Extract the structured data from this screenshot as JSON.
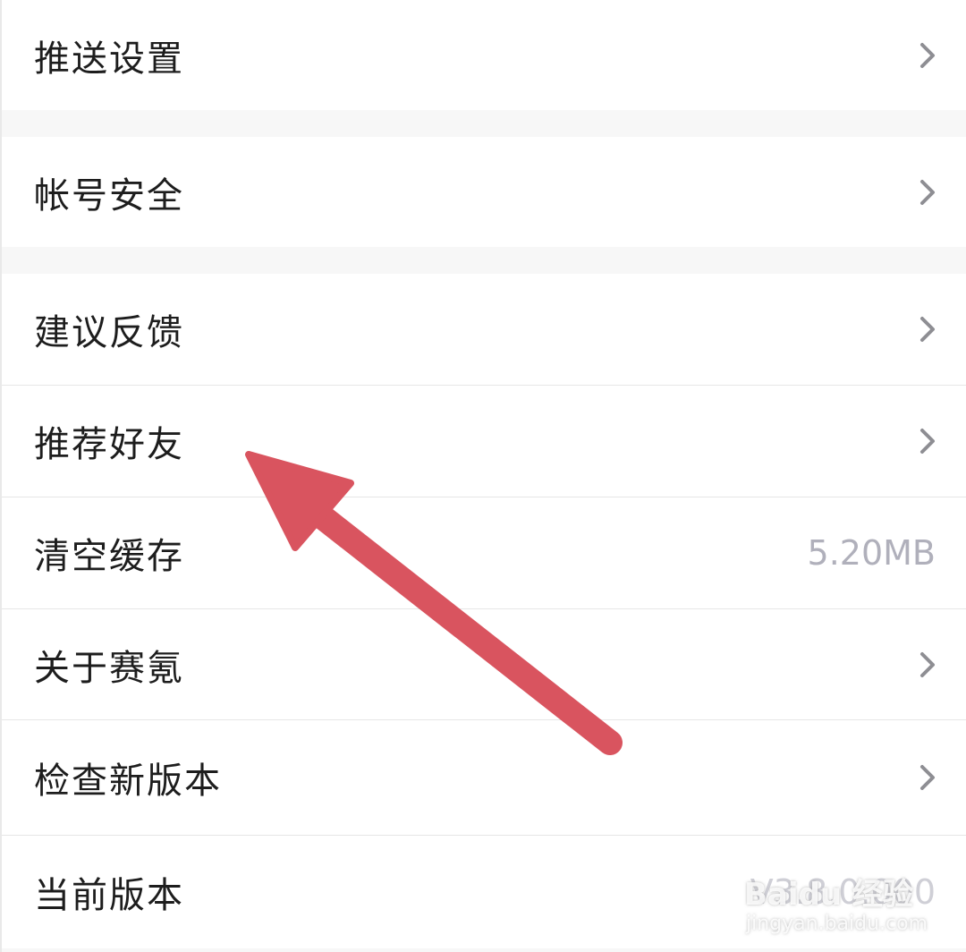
{
  "settings": {
    "items": [
      {
        "label": "推送设置",
        "trailing": "chevron"
      },
      {
        "label": "帐号安全",
        "trailing": "chevron"
      },
      {
        "label": "建议反馈",
        "trailing": "chevron"
      },
      {
        "label": "推荐好友",
        "trailing": "chevron"
      },
      {
        "label": "清空缓存",
        "value": "5.20MB"
      },
      {
        "label": "关于赛氪",
        "trailing": "chevron"
      },
      {
        "label": "检查新版本",
        "trailing": "chevron"
      },
      {
        "label": "当前版本",
        "value": "V3.8.0.000"
      }
    ]
  },
  "annotation": {
    "arrow_color": "#d9545f"
  },
  "watermark": {
    "brand": "Baidu 经验",
    "url": "jingyan.baidu.com"
  },
  "colors": {
    "background": "#f7f7f7",
    "row": "#ffffff",
    "text": "#1d1d1d",
    "value_text": "#b0b0bb",
    "chevron": "#8e8e93"
  },
  "icons": {
    "row_trailing": "chevron-right-icon"
  }
}
